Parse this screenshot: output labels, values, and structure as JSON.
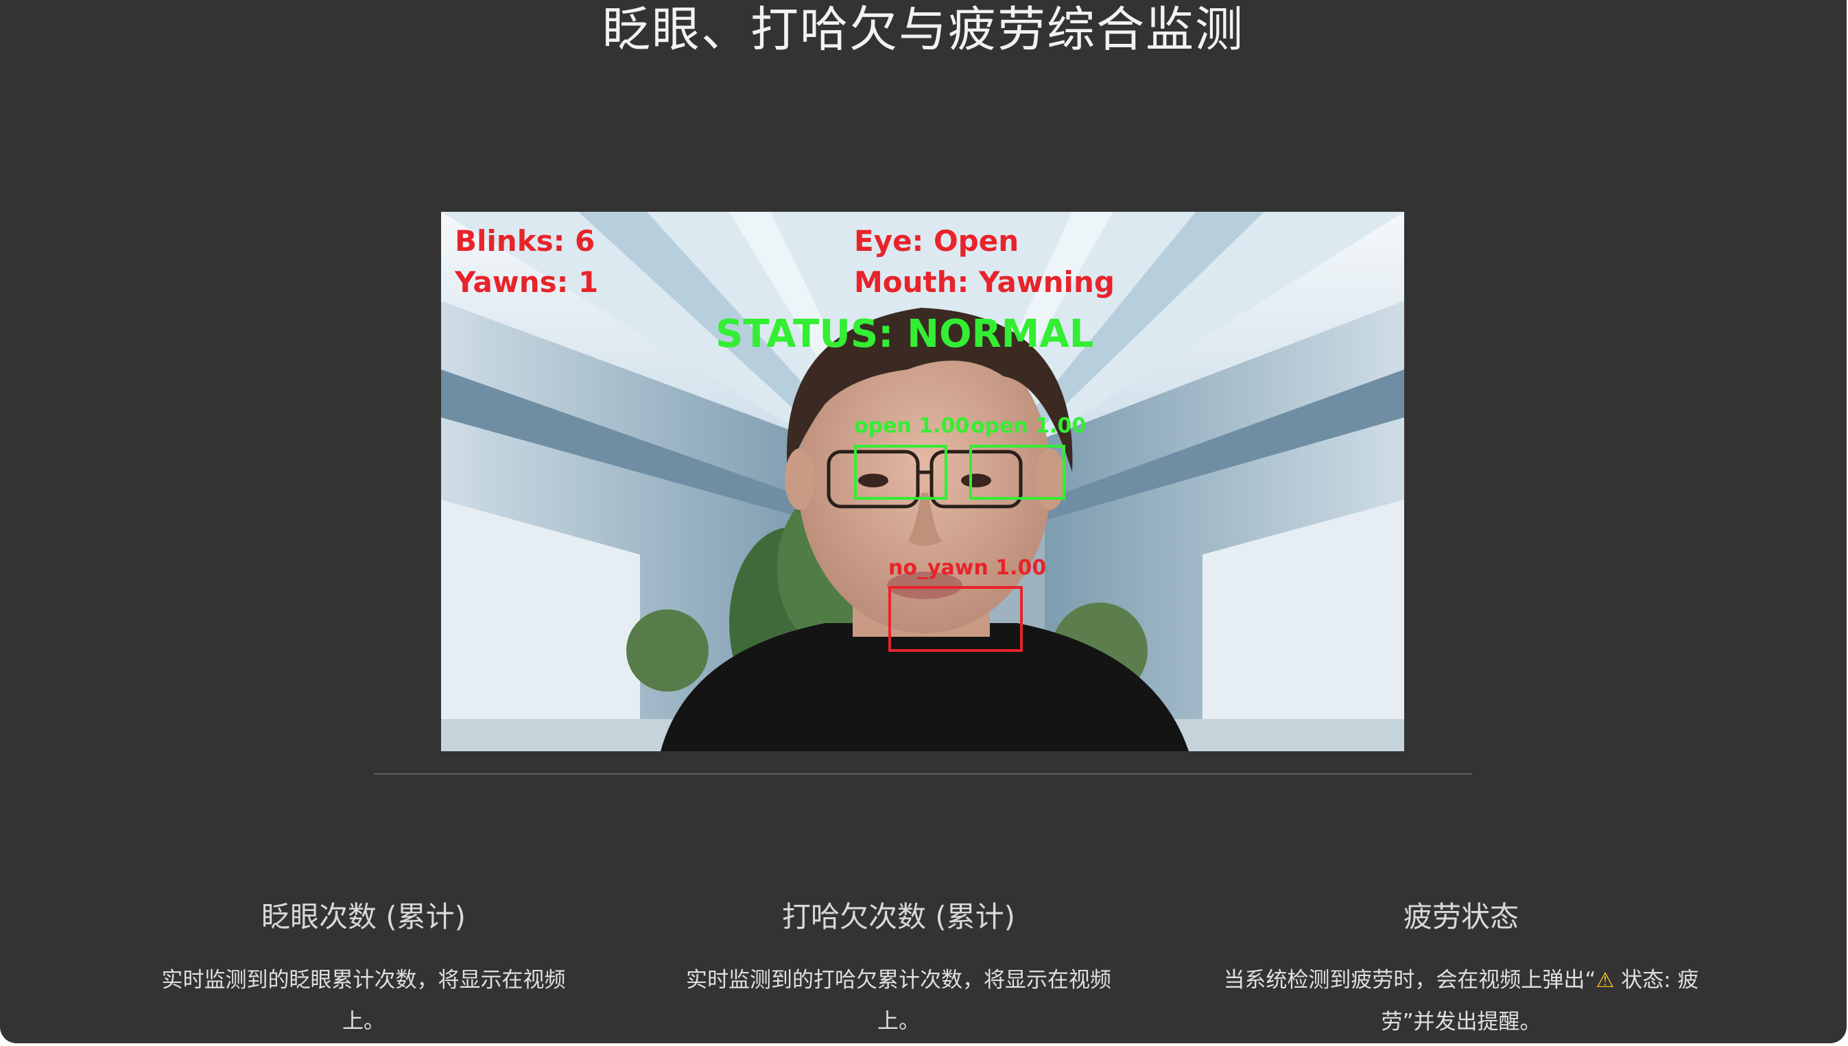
{
  "page": {
    "title": "眨眼、打哈欠与疲劳综合监测"
  },
  "video": {
    "overlay": {
      "blinks": "Blinks: 6",
      "yawns": "Yawns: 1",
      "eye_state": "Eye: Open",
      "mouth_state": "Mouth: Yawning",
      "status": "STATUS: NORMAL",
      "left_eye_label": "open 1.00",
      "right_eye_label": "open 1.00",
      "mouth_label": "no_yawn 1.00"
    },
    "colors": {
      "text_red": "#e8232a",
      "text_green": "#33ee33"
    }
  },
  "cards": [
    {
      "title": "眨眼次数 (累计)",
      "desc_line1": "实时监测到的眨眼累计次数，将显示在视频",
      "desc_line2": "上。"
    },
    {
      "title": "打哈欠次数 (累计)",
      "desc_line1": "实时监测到的打哈欠累计次数，将显示在视频",
      "desc_line2": "上。"
    },
    {
      "title": "疲劳状态",
      "desc_line1_a": "当系统检测到疲劳时，会在视频上弹出“",
      "warn_icon": "⚠",
      "desc_line1_b": " 状态: 疲",
      "desc_line2": "劳”并发出提醒。"
    }
  ],
  "icons": {
    "warning": "warning-icon"
  }
}
